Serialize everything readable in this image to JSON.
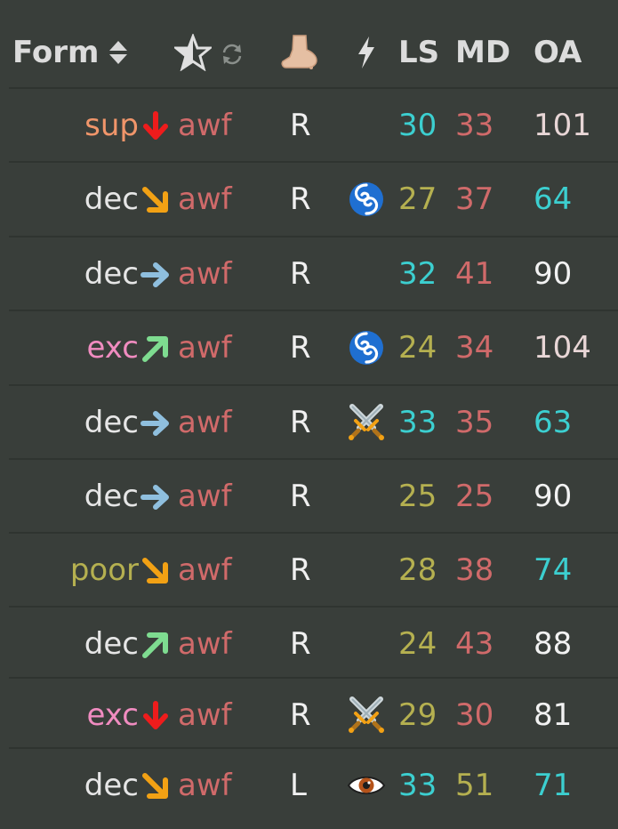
{
  "header": {
    "form": "Form",
    "ls": "LS",
    "md": "MD",
    "oa": "OA",
    "icons": [
      "sort-updown-icon",
      "star-icon",
      "refresh-icon",
      "foot-icon",
      "bolt-icon"
    ]
  },
  "colors": {
    "sup": "#f0956a",
    "dec": "#e6e6e6",
    "exc": "#f08cc0",
    "poor": "#b5b050",
    "awf": "#d06a6a",
    "teal": "#3ccfd0",
    "olive": "#b5b050",
    "red": "#d06a6a",
    "white": "#f2f2f2",
    "pale": "#e8d6d6",
    "arrow_down": "#ee1c1c",
    "arrow_downright": "#f2a114",
    "arrow_right": "#8fbfde",
    "arrow_upright": "#7edc90"
  },
  "rows": [
    {
      "form": "sup",
      "trend": "arrow-down-icon",
      "rating": "awf",
      "foot": "R",
      "special": "",
      "ls": "30",
      "md": "33",
      "oa": "101"
    },
    {
      "form": "dec",
      "trend": "arrow-down-right-icon",
      "rating": "awf",
      "foot": "R",
      "special": "cyclone-icon",
      "ls": "27",
      "md": "37",
      "oa": "64"
    },
    {
      "form": "dec",
      "trend": "arrow-right-icon",
      "rating": "awf",
      "foot": "R",
      "special": "",
      "ls": "32",
      "md": "41",
      "oa": "90"
    },
    {
      "form": "exc",
      "trend": "arrow-up-right-icon",
      "rating": "awf",
      "foot": "R",
      "special": "cyclone-icon",
      "ls": "24",
      "md": "34",
      "oa": "104"
    },
    {
      "form": "dec",
      "trend": "arrow-right-icon",
      "rating": "awf",
      "foot": "R",
      "special": "crossed-swords-icon",
      "ls": "33",
      "md": "35",
      "oa": "63"
    },
    {
      "form": "dec",
      "trend": "arrow-right-icon",
      "rating": "awf",
      "foot": "R",
      "special": "",
      "ls": "25",
      "md": "25",
      "oa": "90"
    },
    {
      "form": "poor",
      "trend": "arrow-down-right-icon",
      "rating": "awf",
      "foot": "R",
      "special": "",
      "ls": "28",
      "md": "38",
      "oa": "74"
    },
    {
      "form": "dec",
      "trend": "arrow-up-right-icon",
      "rating": "awf",
      "foot": "R",
      "special": "",
      "ls": "24",
      "md": "43",
      "oa": "88"
    },
    {
      "form": "exc",
      "trend": "arrow-down-icon",
      "rating": "awf",
      "foot": "R",
      "special": "crossed-swords-icon",
      "ls": "29",
      "md": "30",
      "oa": "81"
    },
    {
      "form": "dec",
      "trend": "arrow-down-right-icon",
      "rating": "awf",
      "foot": "L",
      "special": "eye-icon",
      "ls": "33",
      "md": "51",
      "oa": "71"
    }
  ]
}
